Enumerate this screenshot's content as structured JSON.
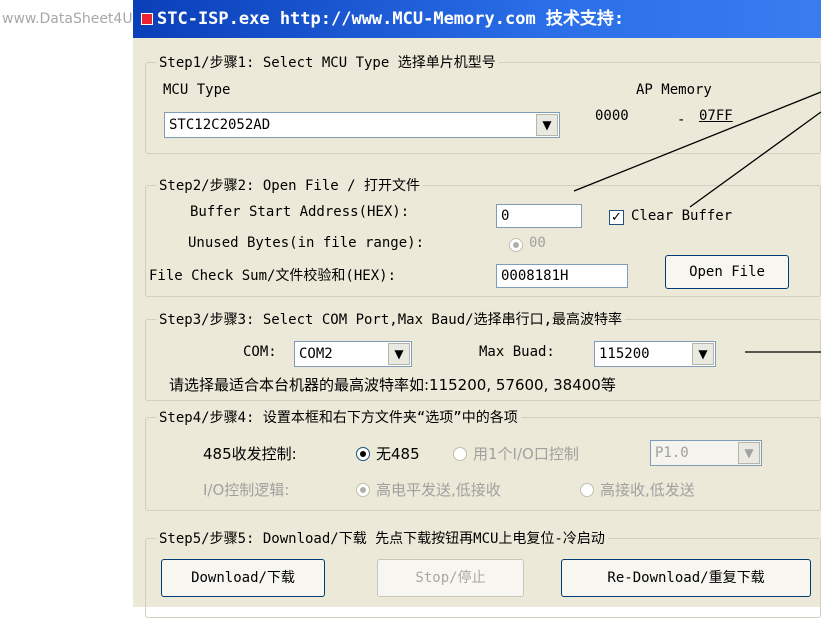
{
  "watermark": "www.DataSheet4U.com",
  "titlebar": {
    "title": "STC-ISP.exe http://www.MCU-Memory.com 技术支持:"
  },
  "step1": {
    "legend": "Step1/步骤1: Select MCU Type  选择单片机型号",
    "mcu_type_label": "MCU Type",
    "mcu_type_value": "STC12C2052AD",
    "ap_memory_label": "AP Memory",
    "ap_start": "0000",
    "ap_dash": "-",
    "ap_end": "07FF"
  },
  "step2": {
    "legend": "Step2/步骤2: Open File / 打开文件",
    "buffer_start_label": "Buffer Start Address(HEX):",
    "buffer_start_value": "0",
    "clear_buffer_label": "Clear Buffer",
    "clear_buffer_checked": true,
    "unused_bytes_label": "Unused Bytes(in file range):",
    "unused_bytes_option": "00",
    "checksum_label": "File Check Sum/文件校验和(HEX):",
    "checksum_value": "0008181H",
    "open_file_label": "Open File"
  },
  "step3": {
    "legend": "Step3/步骤3: Select COM Port,Max Baud/选择串行口,最高波特率",
    "com_label": "COM:",
    "com_value": "COM2",
    "max_baud_label": "Max Buad:",
    "max_baud_value": "115200",
    "hint": "请选择最适合本台机器的最高波特率如:115200, 57600, 38400等"
  },
  "step4": {
    "legend": "Step4/步骤4: 设置本框和右下方文件夹“选项”中的各项",
    "rs485_label": "485收发控制:",
    "rs485_opt_none": "无485",
    "rs485_opt_io": "用1个I/O口控制",
    "rs485_pin": "P1.0",
    "io_logic_label": "I/O控制逻辑:",
    "io_logic_opt_high": "高电平发送,低接收",
    "io_logic_opt_low": "高接收,低发送"
  },
  "step5": {
    "legend": "Step5/步骤5: Download/下载  先点下载按钮再MCU上电复位-冷启动",
    "download_label": "Download/下载",
    "stop_label": "Stop/停止",
    "redownload_label": "Re-Download/重复下载"
  },
  "colors": {
    "titlebar": "#2a6ee8",
    "window_bg": "#ece9d8",
    "group_border": "#d0d0bf",
    "button_border": "#003c74"
  },
  "icons": {
    "app": "app-icon",
    "dropdown": "chevron-down-icon",
    "checkbox": "checkmark-icon"
  }
}
